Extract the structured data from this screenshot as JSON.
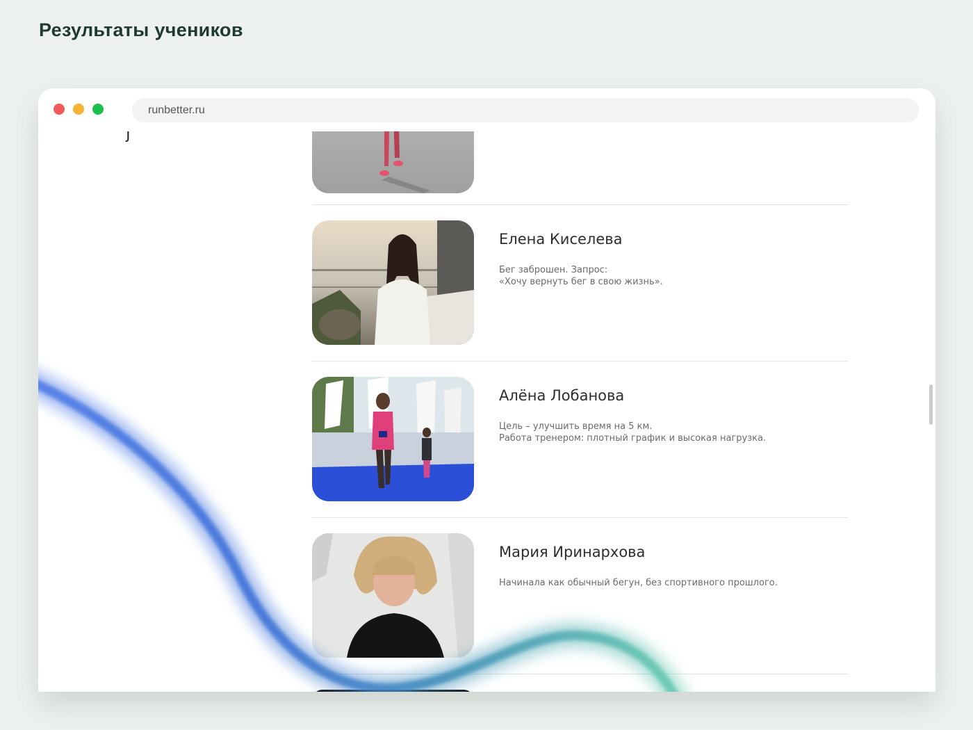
{
  "page": {
    "title": "Результаты учеников"
  },
  "browser": {
    "url": "runbetter.ru",
    "controls": {
      "close_color": "#f15a5a",
      "minimize_color": "#f7b334",
      "maximize_color": "#1cbf4c"
    }
  },
  "colors": {
    "title": "#1f3a2e",
    "wave_start": "#3f6fe0",
    "wave_end": "#5bc6b0"
  },
  "students": [
    {
      "name": "",
      "lines": [],
      "photo_icon": "runner-legs-photo"
    },
    {
      "name": "Елена Киселева",
      "lines": [
        "Бег заброшен. Запрос:",
        "«Хочу вернуть бег в свою жизнь»."
      ],
      "photo_icon": "woman-portrait-photo"
    },
    {
      "name": "Алёна Лобанова",
      "lines": [
        "Цель – улучшить время на 5 км.",
        "Работа тренером: плотный график и высокая нагрузка."
      ],
      "photo_icon": "race-finish-photo"
    },
    {
      "name": "Мария Иринархова",
      "lines": [
        "Начинала как обычный бегун, без спортивного прошлого."
      ],
      "photo_icon": "woman-curly-hair-photo"
    }
  ]
}
